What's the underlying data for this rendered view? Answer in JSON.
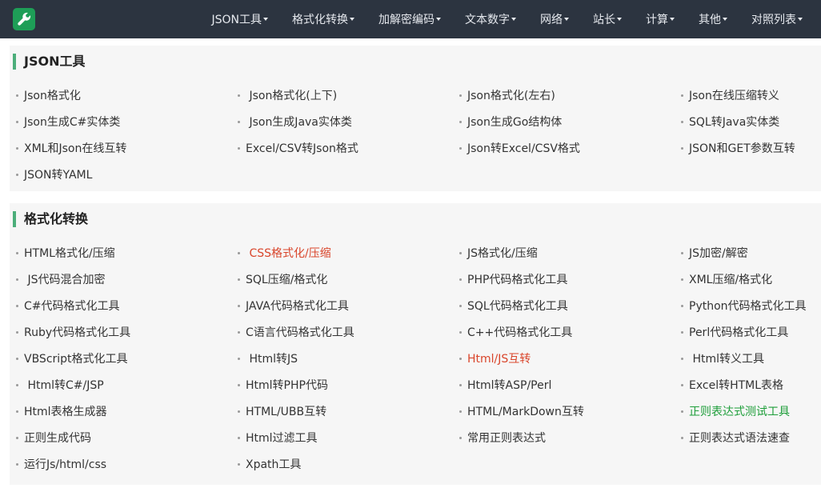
{
  "nav": [
    {
      "label": "JSON工具"
    },
    {
      "label": "格式化转换"
    },
    {
      "label": "加解密编码"
    },
    {
      "label": "文本数字"
    },
    {
      "label": "网络"
    },
    {
      "label": "站长"
    },
    {
      "label": "计算"
    },
    {
      "label": "其他"
    },
    {
      "label": "对照列表"
    }
  ],
  "sections": [
    {
      "title": "JSON工具",
      "items": [
        {
          "label": "Json格式化"
        },
        {
          "label": " Json格式化(上下)"
        },
        {
          "label": "Json格式化(左右)"
        },
        {
          "label": "Json在线压缩转义"
        },
        {
          "label": "Json生成C#实体类"
        },
        {
          "label": " Json生成Java实体类"
        },
        {
          "label": "Json生成Go结构体"
        },
        {
          "label": "SQL转Java实体类"
        },
        {
          "label": "XML和Json在线互转"
        },
        {
          "label": "Excel/CSV转Json格式"
        },
        {
          "label": "Json转Excel/CSV格式"
        },
        {
          "label": "JSON和GET参数互转"
        },
        {
          "label": "JSON转YAML"
        }
      ]
    },
    {
      "title": "格式化转换",
      "items": [
        {
          "label": "HTML格式化/压缩"
        },
        {
          "label": " CSS格式化/压缩",
          "color": "red"
        },
        {
          "label": "JS格式化/压缩"
        },
        {
          "label": "JS加密/解密"
        },
        {
          "label": " JS代码混合加密"
        },
        {
          "label": "SQL压缩/格式化"
        },
        {
          "label": "PHP代码格式化工具"
        },
        {
          "label": "XML压缩/格式化"
        },
        {
          "label": "C#代码格式化工具"
        },
        {
          "label": "JAVA代码格式化工具"
        },
        {
          "label": "SQL代码格式化工具"
        },
        {
          "label": "Python代码格式化工具"
        },
        {
          "label": "Ruby代码格式化工具"
        },
        {
          "label": "C语言代码格式化工具"
        },
        {
          "label": "C++代码格式化工具"
        },
        {
          "label": "Perl代码格式化工具"
        },
        {
          "label": "VBScript格式化工具"
        },
        {
          "label": " Html转JS"
        },
        {
          "label": "Html/JS互转",
          "color": "red"
        },
        {
          "label": " Html转义工具"
        },
        {
          "label": " Html转C#/JSP"
        },
        {
          "label": "Html转PHP代码"
        },
        {
          "label": "Html转ASP/Perl"
        },
        {
          "label": "Excel转HTML表格"
        },
        {
          "label": "Html表格生成器"
        },
        {
          "label": "HTML/UBB互转"
        },
        {
          "label": "HTML/MarkDown互转"
        },
        {
          "label": "正则表达式测试工具",
          "color": "green"
        },
        {
          "label": "正则生成代码"
        },
        {
          "label": "Html过滤工具"
        },
        {
          "label": "常用正则表达式"
        },
        {
          "label": "正则表达式语法速查"
        },
        {
          "label": "运行Js/html/css"
        },
        {
          "label": "Xpath工具"
        }
      ]
    }
  ],
  "colors": {
    "topbar": "#2c3440",
    "logo": "#1e9e57",
    "accent_bar": "#4cae7a",
    "red_link": "#d9452b",
    "green_link": "#1e9e3a"
  },
  "icons": {
    "logo": "wrench-icon",
    "nav_caret": "caret-down-icon"
  }
}
